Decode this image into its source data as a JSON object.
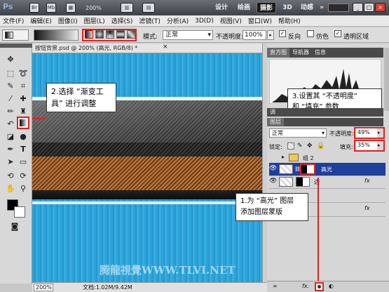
{
  "app": {
    "logo": "Ps",
    "icon_br": "Br",
    "icon_mb": "Mb",
    "zoom": "200%",
    "workspaces": [
      "设计",
      "绘画",
      "摄影",
      "3D",
      "动感"
    ],
    "overflow": "»",
    "search_placeholder": "",
    "window_buttons": [
      "_",
      "□",
      "×"
    ]
  },
  "menu": [
    "文件(F)",
    "编辑(E)",
    "图像(I)",
    "图层(L)",
    "选择(S)",
    "滤镜(T)",
    "分析(A)",
    "3D(D)",
    "视图(V)",
    "窗口(W)",
    "帮助(H)"
  ],
  "options": {
    "mode_label": "模式:",
    "mode_value": "正常",
    "opacity_label": "不透明度:",
    "opacity_value": "100%",
    "reverse_label": "反向",
    "dither_label": "仿色",
    "transparency_label": "透明区域",
    "check_mark": "✓"
  },
  "document": {
    "title": "按钮背景.psd @ 200% (高光, RGB/8) *",
    "close": "×",
    "zoom_status": "200%",
    "doc_size": "文档:1.02M/9.42M"
  },
  "panels": {
    "tabs": [
      "直方图",
      "导航器",
      "信息"
    ],
    "adjust_tab": "调",
    "layers_tab": "图层",
    "blend_mode": "正常",
    "opacity_label": "不透明度:",
    "opacity_value": "49%",
    "lock_label": "锁定:",
    "fill_label": "填充:",
    "fill_value": "35%",
    "fx": "fx",
    "layers": [
      {
        "name": "组 2",
        "type": "group"
      },
      {
        "name": "高光",
        "type": "layer",
        "selected": true
      },
      {
        "name": "边",
        "type": "layer",
        "fx": true
      }
    ]
  },
  "callouts": {
    "c2_line1": "2.选择 “渐变工",
    "c2_line2": "具” 进行调整",
    "c3_line1": "3.设置其 “不透明度”",
    "c3_line2": "和 “填充” 参数",
    "c1_line1": "1.为 “高光” 图层",
    "c1_line2": "添加图层蒙版"
  },
  "watermark": "腾龍視覺WWW.TLVI.NET",
  "colors": {
    "canvas_blue": "#2aa0d6",
    "callout_border": "#e02020",
    "selected_layer": "#1e3f9a"
  }
}
